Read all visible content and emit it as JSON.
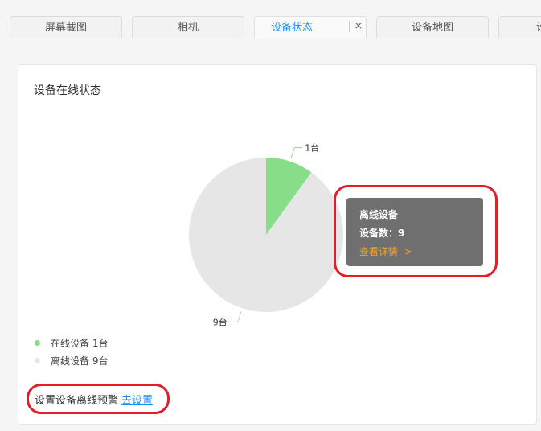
{
  "tabs": [
    {
      "label": "屏幕截图"
    },
    {
      "label": "相机"
    },
    {
      "label": "设备状态",
      "active": true
    },
    {
      "label": "设备地图"
    },
    {
      "label": "设"
    }
  ],
  "tab_close": "×",
  "card": {
    "title": "设备在线状态"
  },
  "chart_data": {
    "type": "pie",
    "categories": [
      "在线设备",
      "离线设备"
    ],
    "values": [
      1,
      9
    ],
    "slice_labels": [
      "1台",
      "9台"
    ],
    "colors": [
      "#88dd88",
      "#e6e6e6"
    ]
  },
  "tooltip": {
    "title": "离线设备",
    "count_label": "设备数：9",
    "link": "查看详情 ->"
  },
  "legend": [
    {
      "label": "在线设备 1台",
      "color": "#88dd88"
    },
    {
      "label": "离线设备 9台",
      "color": "#e6e6e6"
    }
  ],
  "footer": {
    "text": "设置设备离线预警",
    "link": "去设置"
  },
  "annotation_color": "#e31d2a"
}
